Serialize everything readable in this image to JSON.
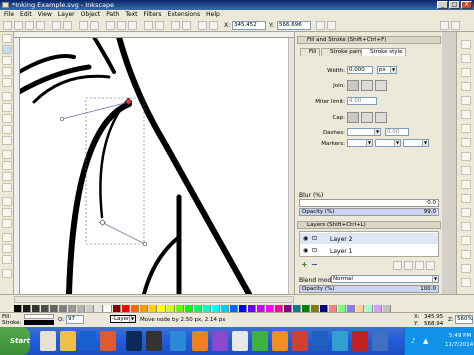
{
  "window": {
    "title": "*Inking Example.svg - Inkscape",
    "buttons": [
      "_",
      "□",
      "X"
    ]
  },
  "menubar": [
    "File",
    "Edit",
    "View",
    "Layer",
    "Object",
    "Path",
    "Text",
    "Filters",
    "Extensions",
    "Help"
  ],
  "toolcontrols": {
    "x_label": "X:",
    "x_value": "345.452",
    "y_label": "Y:",
    "y_value": "566.696"
  },
  "fill_stroke": {
    "title": "Fill and Stroke (Shift+Ctrl+F)",
    "tabs": [
      "Fill",
      "Stroke paint",
      "Stroke style"
    ],
    "width_label": "Width:",
    "width_value": "0.000",
    "width_unit": "px",
    "join_label": "Join:",
    "miter_label": "Miter limit:",
    "miter_value": "4.00",
    "cap_label": "Cap:",
    "dashes_label": "Dashes:",
    "dashes_value": "0.00",
    "markers_label": "Markers:",
    "blur_label": "Blur (%)",
    "blur_value": "0.0",
    "opacity_label": "Opacity (%)",
    "opacity_value": "99.0"
  },
  "layers": {
    "title": "Layers (Shift+Ctrl+L)",
    "items": [
      "Layer 2",
      "Layer 1"
    ],
    "add": "+",
    "remove": "−",
    "blend_label": "Blend mode:",
    "blend_value": "Normal",
    "opacity_label": "Opacity (%)",
    "opacity_value": "100.0"
  },
  "palette_colors": [
    "#000000",
    "#1a1a1a",
    "#333333",
    "#4d4d4d",
    "#666666",
    "#808080",
    "#999999",
    "#b3b3b3",
    "#cccccc",
    "#e6e6e6",
    "#ffffff",
    "#800000",
    "#ff0000",
    "#ff6600",
    "#ff9900",
    "#ffcc00",
    "#ffff00",
    "#ccff00",
    "#66ff00",
    "#00ff00",
    "#00ff66",
    "#00ffcc",
    "#00ffff",
    "#00ccff",
    "#0066ff",
    "#0000ff",
    "#6600ff",
    "#cc00ff",
    "#ff00ff",
    "#ff0099",
    "#800080",
    "#008080",
    "#008000",
    "#808000",
    "#000080",
    "#ff8080",
    "#80ff80",
    "#8080ff",
    "#ffd0a0",
    "#a0ffd0",
    "#d0a0ff",
    "#c0c0c0"
  ],
  "status": {
    "fill_label": "Fill:",
    "stroke_label": "Stroke:",
    "opacity_label": "O:",
    "opacity_value": "97",
    "layer_value": "-Layer 2",
    "message": "Move node by 2.50 px, 2.14 px",
    "coords_x_label": "X:",
    "coords_x": "345.95",
    "coords_y_label": "Y:",
    "coords_y": "568.94",
    "zoom_label": "Z:",
    "zoom_value": "560%"
  },
  "taskbar": {
    "start": "Start",
    "time": "5:49 PM",
    "date": "11/7/2014"
  }
}
